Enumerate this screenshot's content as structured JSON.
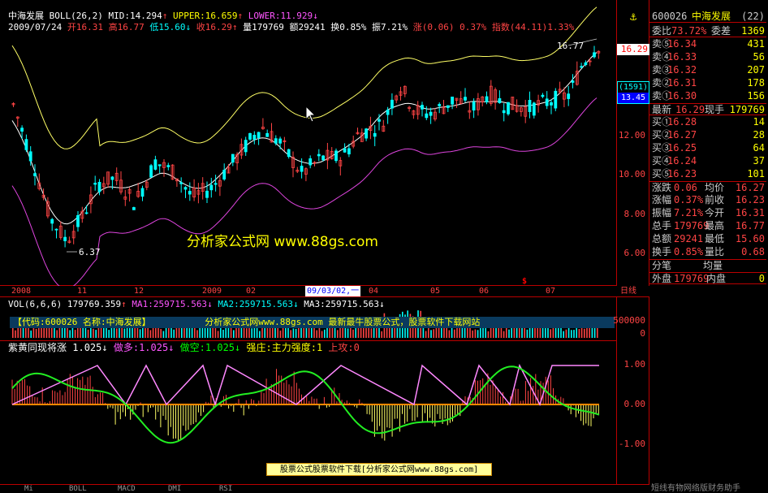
{
  "header": {
    "stock_name": "中海发展",
    "indicator": "BOLL(26,2)",
    "mid": "MID:14.294",
    "mid_arrow": "↑",
    "upper": "UPPER:16.659",
    "upper_arrow": "↑",
    "lower": "LOWER:11.929",
    "lower_arrow": "↓"
  },
  "quote_line": {
    "date": "2009/07/24",
    "open_label": "开",
    "open": "16.31",
    "high_label": "高",
    "high": "16.77",
    "low_label": "低",
    "low": "15.60",
    "close_label": "收",
    "close": "16.29",
    "vol_label": "量",
    "vol": "179769",
    "amt_label": "额",
    "amt": "29241",
    "turn_label": "换",
    "turn": "0.85%",
    "amp_label": "振",
    "amp": "7.21%",
    "chg_label": "涨",
    "chg": "(0.06)",
    "chg_pct": "0.37%",
    "idx_label": "指数",
    "idx": "(44.11)",
    "idx_pct": "1.33%"
  },
  "chart_labels": {
    "high_mark": "16.77",
    "low_mark": "6.37",
    "current_price": "16.29",
    "count_badge": "(1591)",
    "count_value": "13.45"
  },
  "price_axis": [
    "12.00",
    "10.00",
    "8.00",
    "6.00"
  ],
  "timeline": [
    "2008",
    "11",
    "12",
    "2009",
    "02",
    "09/03/02,一",
    "04",
    "05",
    "06",
    "07"
  ],
  "timeline_marker": "$",
  "timeline_right": "日线",
  "volume": {
    "title": "VOL(6,6,6)",
    "value": "179769.359",
    "value_arrow": "↑",
    "ma1": "MA1:259715.563",
    "ma1_arrow": "↓",
    "ma2": "MA2:259715.563",
    "ma2_arrow": "↓",
    "ma3": "MA3:259715.563",
    "ma3_arrow": "↓",
    "axis": "500000",
    "axis_zero": "0"
  },
  "banner_top": {
    "code": "【代码:600026  名称:中海发展】",
    "middle": "分析家公式网www.88gs.com 最新最牛股票公式，股票软件下载网站"
  },
  "indicator2": {
    "title": "紫黄同现将涨",
    "value": "1.025",
    "value_arrow": "↓",
    "bull": "做多:1.025",
    "bull_arrow": "↓",
    "bear": "做空:1.025",
    "bear_arrow": "↓",
    "strong": "强庄:主力强度:1",
    "up": "上攻:0",
    "axis": [
      "1.00",
      "0.00",
      "-1.00"
    ]
  },
  "watermark": "分析家公式网 www.88gs.com",
  "bottom_banner": "股票公式股票软件下载[分析家公式网www.88gs.com]",
  "bottom_tabs": [
    "Mi",
    "BOLL",
    "MACD",
    "DMI",
    "RSI"
  ],
  "side": {
    "code": "600026",
    "name": "中海发展",
    "num": "(22)",
    "ratio_label": "委比",
    "ratio": "73.72%",
    "diff_label": "委差",
    "diff": "1369",
    "sells": [
      {
        "label": "卖⑤",
        "price": "16.34",
        "vol": "431"
      },
      {
        "label": "卖④",
        "price": "16.33",
        "vol": "56"
      },
      {
        "label": "卖③",
        "price": "16.32",
        "vol": "207"
      },
      {
        "label": "卖②",
        "price": "16.31",
        "vol": "178"
      },
      {
        "label": "卖①",
        "price": "16.30",
        "vol": "156"
      }
    ],
    "last_label": "最新",
    "last": "16.29",
    "cur_label": "现手",
    "cur": "179769",
    "buys": [
      {
        "label": "买①",
        "price": "16.28",
        "vol": "14"
      },
      {
        "label": "买②",
        "price": "16.27",
        "vol": "28"
      },
      {
        "label": "买③",
        "price": "16.25",
        "vol": "64"
      },
      {
        "label": "买④",
        "price": "16.24",
        "vol": "37"
      },
      {
        "label": "买⑤",
        "price": "16.23",
        "vol": "101"
      }
    ],
    "stats": [
      {
        "l1": "涨跌",
        "v1": "0.06",
        "l2": "均价",
        "v2": "16.27"
      },
      {
        "l1": "涨幅",
        "v1": "0.37%",
        "l2": "前收",
        "v2": "16.23"
      },
      {
        "l1": "振幅",
        "v1": "7.21%",
        "l2": "今开",
        "v2": "16.31"
      },
      {
        "l1": "总手",
        "v1": "179769",
        "l2": "最高",
        "v2": "16.77"
      },
      {
        "l1": "总额",
        "v1": "29241",
        "l2": "最低",
        "v2": "15.60"
      },
      {
        "l1": "换手",
        "v1": "0.85%",
        "l2": "量比",
        "v2": "0.68"
      }
    ],
    "tick_label": "分笔",
    "avg_label": "均量",
    "outer_label": "外盘",
    "outer": "179769",
    "inner_label": "内盘",
    "inner": "0",
    "footer": "短线有物网络版财务助手"
  },
  "colors": {
    "bg": "#000000",
    "border": "#bb0000",
    "up": "#ff4444",
    "down": "#00ffff",
    "upper": "#ffff66",
    "mid": "#ffffff",
    "lower": "#dd44dd"
  }
}
